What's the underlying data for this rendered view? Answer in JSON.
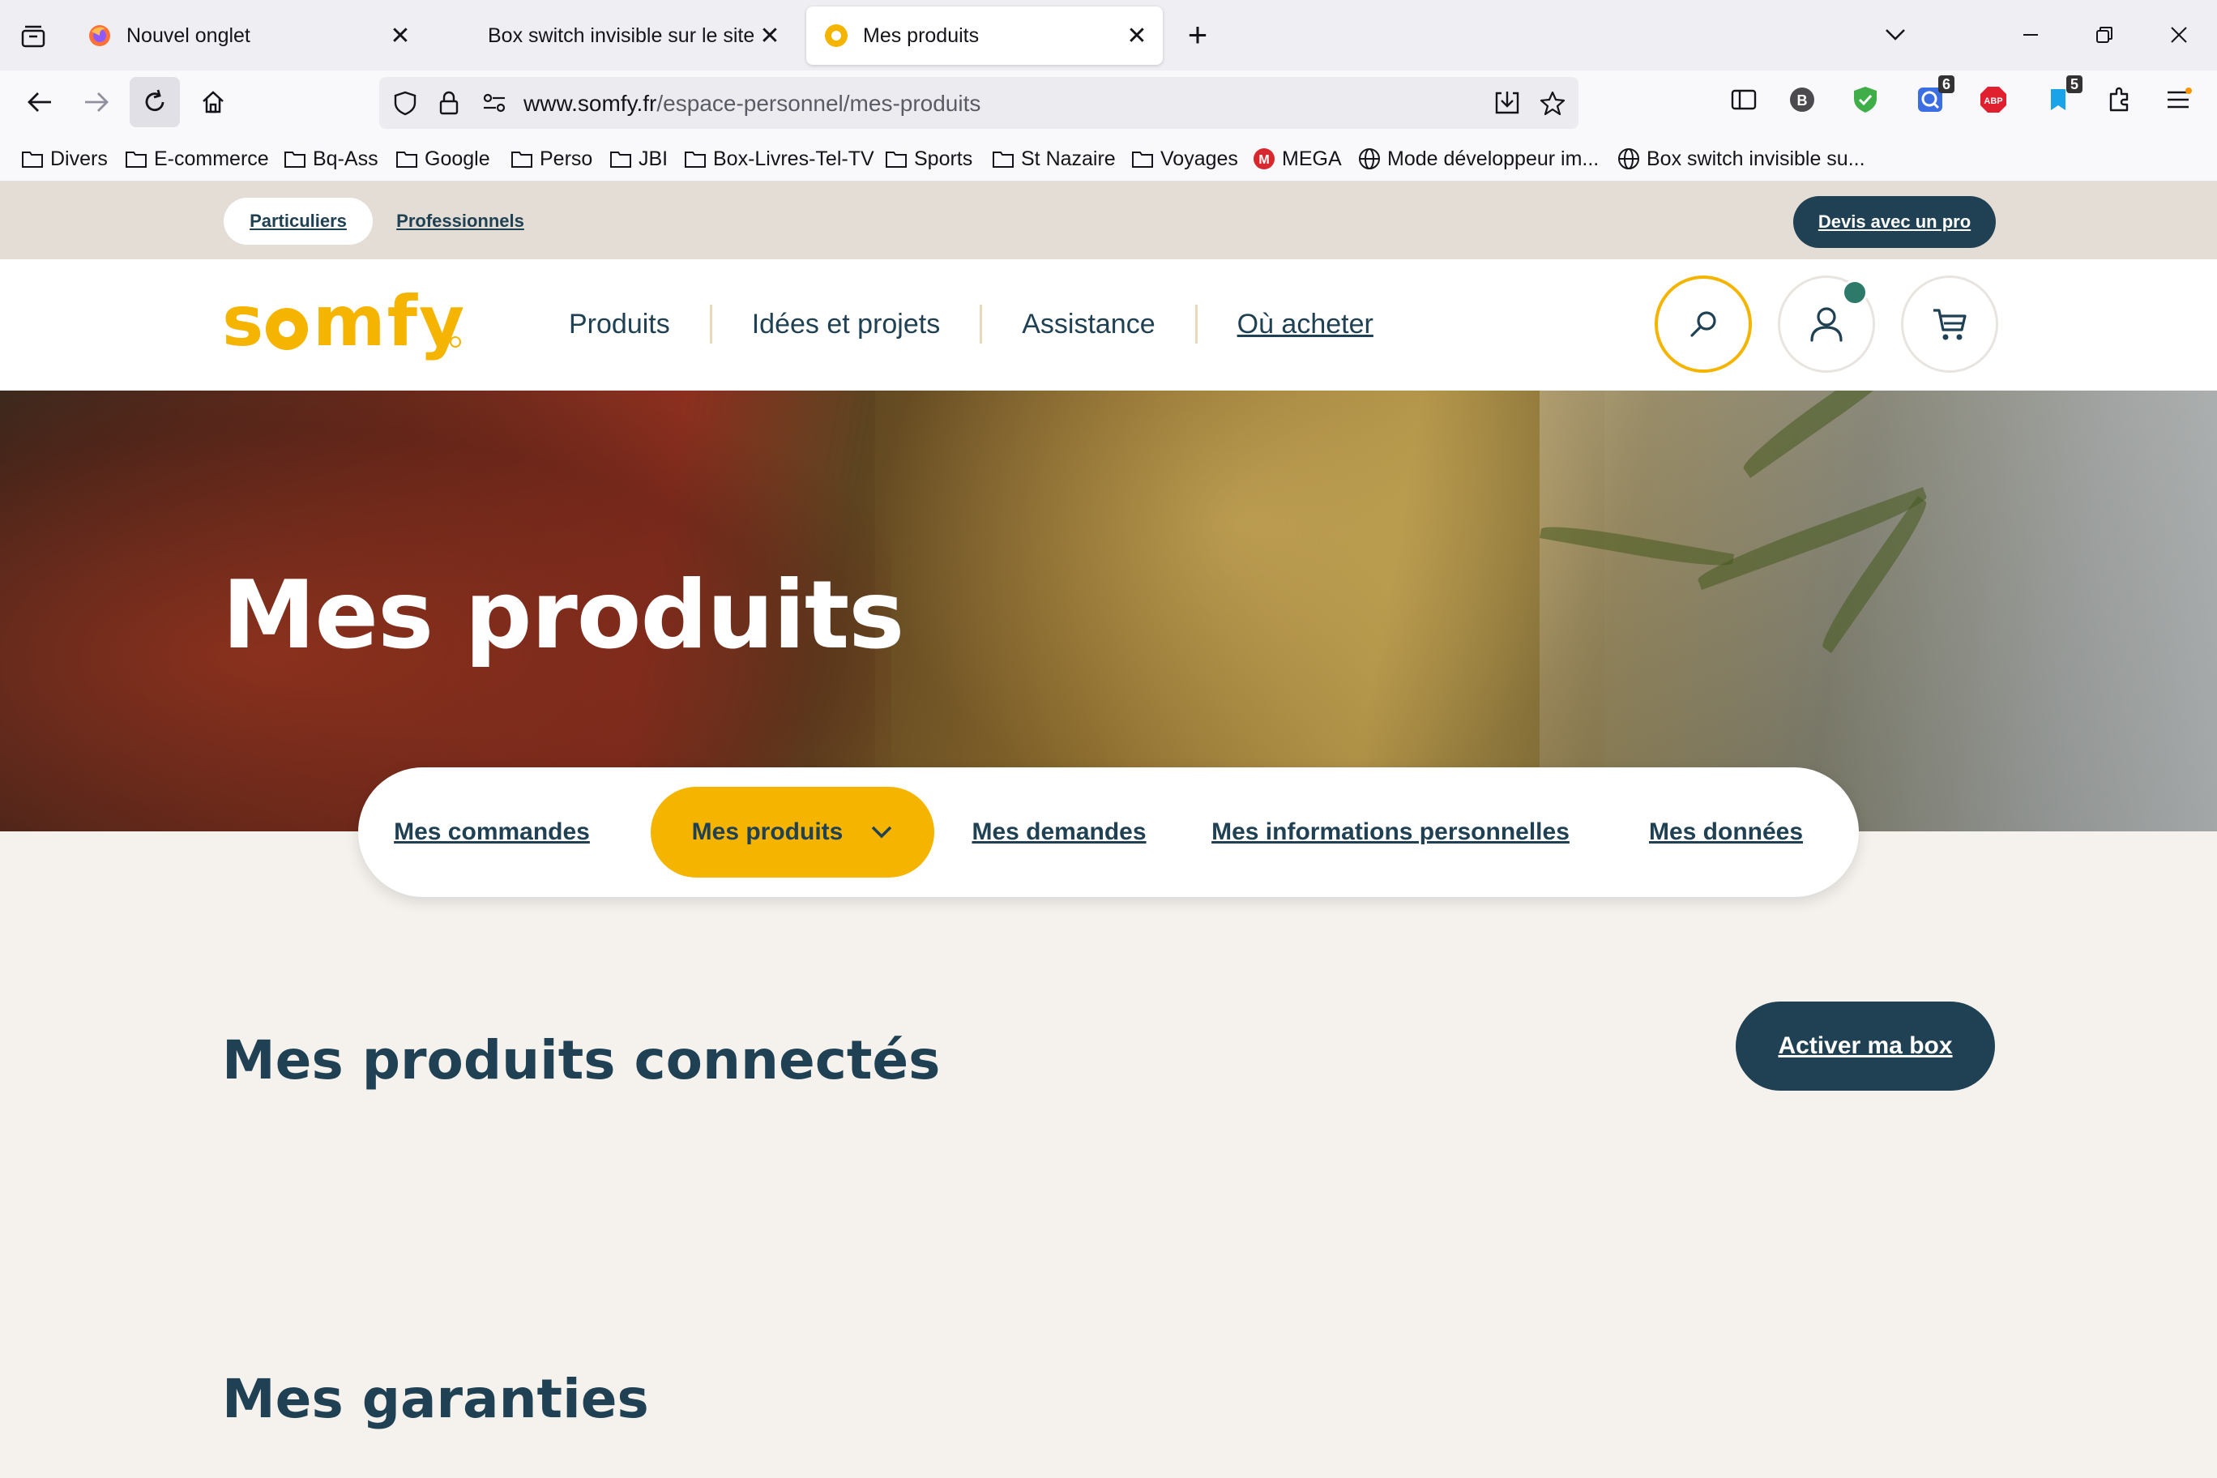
{
  "browser": {
    "tabs": [
      {
        "label": "Nouvel onglet",
        "favicon": "firefox-icon",
        "active": false
      },
      {
        "label": "Box switch invisible sur le site - ",
        "favicon": "none",
        "active": false
      },
      {
        "label": "Mes produits",
        "favicon": "somfy-favicon",
        "active": true
      }
    ],
    "url_host": "www.somfy.fr",
    "url_path": "/espace-personnel/mes-produits",
    "extension_badges": {
      "ext_q": "6",
      "ext_tab": "5"
    },
    "bookmarks": [
      {
        "label": "Divers",
        "icon": "folder-icon"
      },
      {
        "label": "E-commerce",
        "icon": "folder-icon"
      },
      {
        "label": "Bq-Ass",
        "icon": "folder-icon"
      },
      {
        "label": "Google",
        "icon": "folder-icon"
      },
      {
        "label": "Perso",
        "icon": "folder-icon"
      },
      {
        "label": "JBI",
        "icon": "folder-icon"
      },
      {
        "label": "Box-Livres-Tel-TV",
        "icon": "folder-icon"
      },
      {
        "label": "Sports",
        "icon": "folder-icon"
      },
      {
        "label": "St Nazaire",
        "icon": "folder-icon"
      },
      {
        "label": "Voyages",
        "icon": "folder-icon"
      },
      {
        "label": "MEGA",
        "icon": "mega-icon"
      },
      {
        "label": "Mode développeur im...",
        "icon": "globe-icon"
      },
      {
        "label": "Box switch invisible su...",
        "icon": "globe-icon"
      }
    ]
  },
  "site": {
    "brand_color": "#f5b400",
    "dark_color": "#1f4153",
    "segments": {
      "particuliers": "Particuliers",
      "professionnels": "Professionnels"
    },
    "devis_button": "Devis avec un pro",
    "logo": "somfy",
    "nav": {
      "produits": "Produits",
      "idees": "Idées et projets",
      "assistance": "Assistance",
      "ou_acheter": "Où acheter"
    },
    "hero_title": "Mes produits",
    "subnav": {
      "commandes": "Mes commandes",
      "produits": "Mes produits",
      "demandes": "Mes demandes",
      "infos": "Mes informations personnelles",
      "donnees": "Mes données"
    },
    "section_connected": "Mes produits connectés",
    "activate_button": "Activer ma box",
    "section_warranties": "Mes garanties"
  }
}
